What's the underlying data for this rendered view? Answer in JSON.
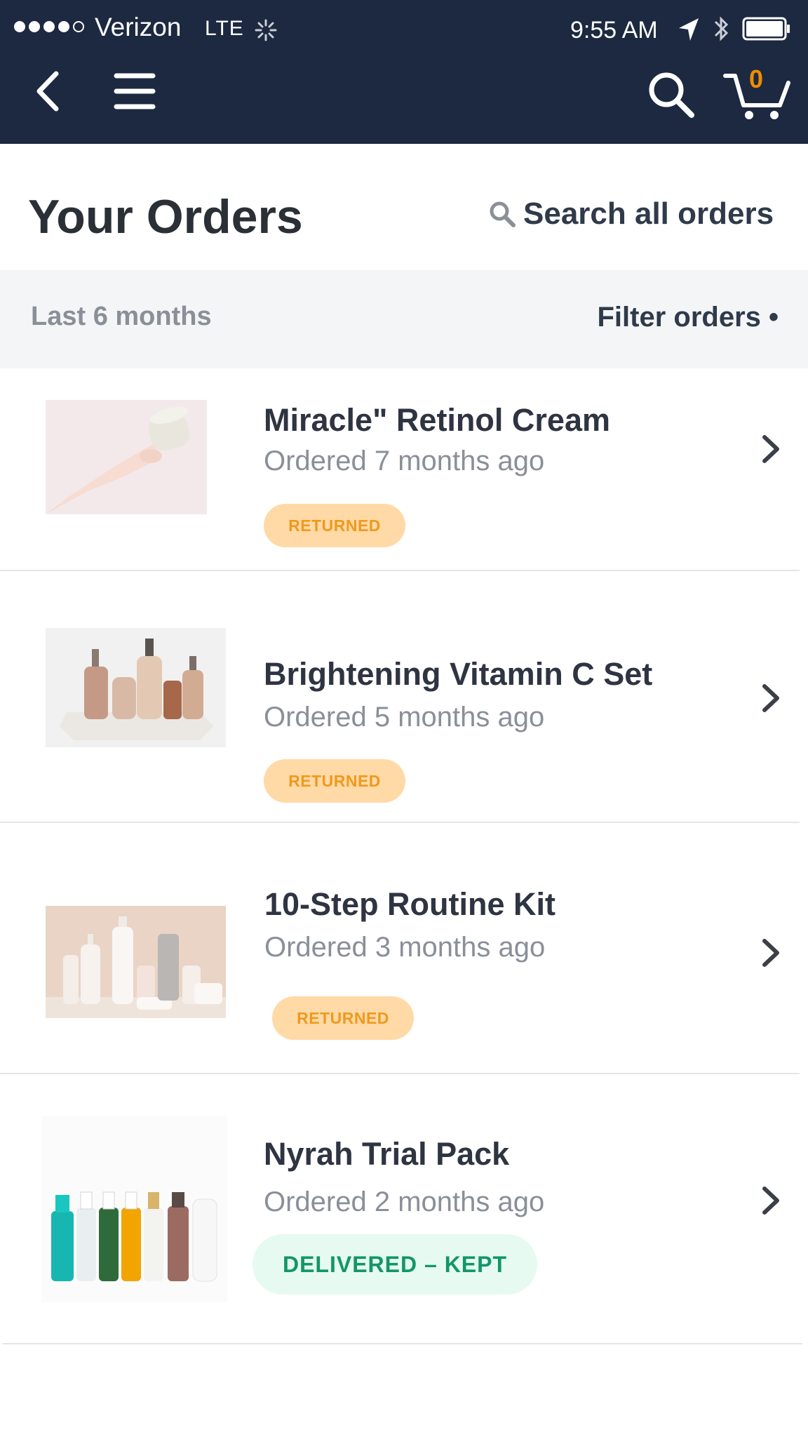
{
  "status_bar": {
    "carrier": "Verizon",
    "network": "LTE",
    "time": "9:55 AM"
  },
  "nav": {
    "cart_count": "0"
  },
  "header": {
    "title": "Your Orders",
    "search_label": "Search all orders"
  },
  "filter": {
    "range_label": "Last 6 months",
    "filter_label": "Filter orders •"
  },
  "orders": [
    {
      "title": "Miracle\" Retinol Cream",
      "date": "Ordered 7 months ago",
      "status": "RETURNED"
    },
    {
      "title": "Brightening Vitamin C Set",
      "date": "Ordered 5 months ago",
      "status": "RETURNED"
    },
    {
      "title": "10-Step Routine Kit",
      "date": " Ordered 3 months ago",
      "status": "RETURNED"
    },
    {
      "title": "Nyrah Trial Pack",
      "date": "Ordered 2 months ago",
      "status": "DELIVERED – KEPT"
    }
  ],
  "colors": {
    "nav_bg": "#1c2940",
    "returned_badge_bg": "#ffd9a6",
    "returned_badge_text": "#ee9a1e",
    "kept_badge_bg": "#e6faf1",
    "kept_badge_text": "#129668",
    "cart_count": "#f08c00"
  }
}
